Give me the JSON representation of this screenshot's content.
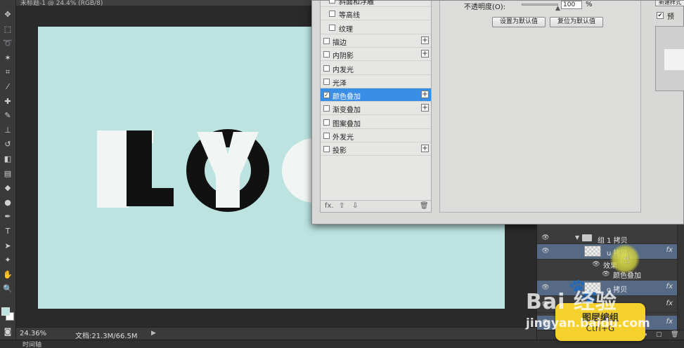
{
  "document": {
    "tab_title": "未标题-1 @ 24.4% (RGB/8)",
    "zoom": "24.36%",
    "doc_info": "文档:21.3M/66.5M",
    "status_arrow": "▶"
  },
  "bottom_panel": {
    "timeline_label": "时间轴"
  },
  "tools": [
    {
      "icon": "move-icon",
      "glyph": "✥"
    },
    {
      "icon": "marquee-icon",
      "glyph": "⬚"
    },
    {
      "icon": "lasso-icon",
      "glyph": "➰"
    },
    {
      "icon": "magic-wand-icon",
      "glyph": "✶"
    },
    {
      "icon": "crop-icon",
      "glyph": "⌗"
    },
    {
      "icon": "eyedropper-icon",
      "glyph": "⁄"
    },
    {
      "icon": "healing-brush-icon",
      "glyph": "✚"
    },
    {
      "icon": "brush-icon",
      "glyph": "✎"
    },
    {
      "icon": "stamp-icon",
      "glyph": "⊥"
    },
    {
      "icon": "history-brush-icon",
      "glyph": "↺"
    },
    {
      "icon": "eraser-icon",
      "glyph": "◧"
    },
    {
      "icon": "gradient-icon",
      "glyph": "▤"
    },
    {
      "icon": "blur-icon",
      "glyph": "◆"
    },
    {
      "icon": "dodge-icon",
      "glyph": "●"
    },
    {
      "icon": "pen-icon",
      "glyph": "✒"
    },
    {
      "icon": "type-icon",
      "glyph": "T"
    },
    {
      "icon": "path-select-icon",
      "glyph": "➤"
    },
    {
      "icon": "shape-icon",
      "glyph": "✦"
    },
    {
      "icon": "hand-icon",
      "glyph": "✋"
    },
    {
      "icon": "zoom-icon",
      "glyph": "🔍"
    }
  ],
  "canvas": {
    "background_color": "#bce3e0",
    "logo_letters": [
      {
        "text": "I",
        "color": "#f1f5f3"
      },
      {
        "text": "L",
        "color": "#111111"
      },
      {
        "text": "Y",
        "color": "#f1f5f3"
      },
      {
        "text": "O",
        "color": "#111111"
      }
    ]
  },
  "layer_style_dialog": {
    "styles": [
      {
        "label": "斜面和浮雕",
        "checked": false,
        "plus": false,
        "selected": false,
        "indent": true
      },
      {
        "label": "等高线",
        "checked": false,
        "plus": false,
        "selected": false,
        "indent": true
      },
      {
        "label": "纹理",
        "checked": false,
        "plus": false,
        "selected": false,
        "indent": true
      },
      {
        "label": "描边",
        "checked": false,
        "plus": true,
        "selected": false,
        "indent": false
      },
      {
        "label": "内阴影",
        "checked": false,
        "plus": true,
        "selected": false,
        "indent": false
      },
      {
        "label": "内发光",
        "checked": false,
        "plus": false,
        "selected": false,
        "indent": false
      },
      {
        "label": "光泽",
        "checked": false,
        "plus": false,
        "selected": false,
        "indent": false
      },
      {
        "label": "颜色叠加",
        "checked": true,
        "plus": true,
        "selected": true,
        "indent": false
      },
      {
        "label": "渐变叠加",
        "checked": false,
        "plus": true,
        "selected": false,
        "indent": false
      },
      {
        "label": "图案叠加",
        "checked": false,
        "plus": false,
        "selected": false,
        "indent": false
      },
      {
        "label": "外发光",
        "checked": false,
        "plus": false,
        "selected": false,
        "indent": false
      },
      {
        "label": "投影",
        "checked": false,
        "plus": true,
        "selected": false,
        "indent": false
      }
    ],
    "footer": {
      "fx": "fx.",
      "up": "⇧",
      "down": "⇩",
      "trash": "🗑"
    },
    "opacity_label": "不透明度(O):",
    "opacity_value": "100",
    "opacity_unit": "%",
    "set_default_label": "设置为默认值",
    "reset_default_label": "复位为默认值",
    "new_style_label": "新建样式",
    "preview_label": "预",
    "preview_checked": true
  },
  "layers_panel": {
    "rows": [
      {
        "kind": "group",
        "name": "组 1 拷贝",
        "selected": false,
        "fx": false,
        "thumb": false
      },
      {
        "kind": "layer",
        "name": "u 拷贝",
        "selected": true,
        "fx": true,
        "thumb": true
      },
      {
        "kind": "effects",
        "name": "效果",
        "selected": false,
        "fx": false,
        "thumb": false
      },
      {
        "kind": "effect",
        "name": "颜色叠加",
        "selected": false,
        "fx": false,
        "thumb": false
      },
      {
        "kind": "layer",
        "name": "o 拷贝",
        "selected": true,
        "fx": true,
        "thumb": true
      },
      {
        "kind": "hidden",
        "name": "",
        "selected": false,
        "fx": true,
        "thumb": false
      },
      {
        "kind": "hidden",
        "name": "",
        "selected": true,
        "fx": true,
        "thumb": false
      }
    ],
    "footer_icons": [
      "link-icon",
      "fx-icon",
      "mask-icon",
      "adjustment-icon",
      "folder-icon",
      "new-layer-icon",
      "trash-icon"
    ]
  },
  "tooltip": {
    "title": "图层编组",
    "shortcut": "Ctrl+G"
  },
  "watermark": {
    "brand": "Bai  经验",
    "url": "jingyan.baidu.com"
  }
}
